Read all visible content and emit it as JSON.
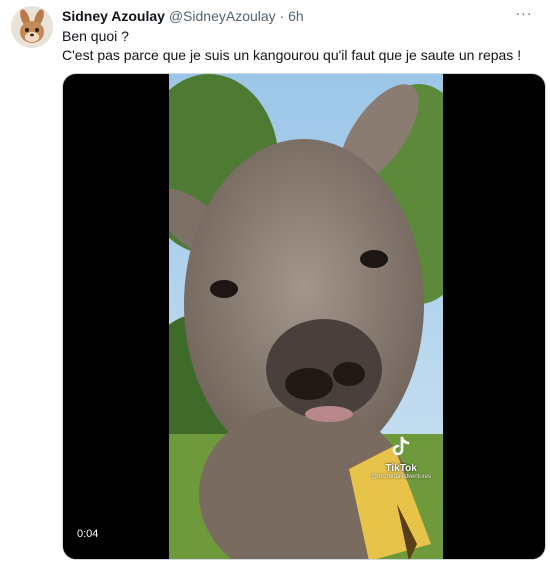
{
  "author": {
    "name": "Sidney Azoulay",
    "handle": "@SidneyAzoulay",
    "separator": "·",
    "time": "6h"
  },
  "more_label": "···",
  "tweet": {
    "lines": [
      "Ben quoi ?",
      "C'est pas parce que je suis un kangourou qu'il faut que je saute un repas !"
    ]
  },
  "media": {
    "watermark_brand": "TikTok",
    "watermark_user": "@mcmedavidventures",
    "duration": "0:04"
  },
  "icons": {
    "avatar": "squirrel-avatar",
    "more": "more-options-icon",
    "tiktok": "tiktok-logo-icon"
  },
  "colors": {
    "text_primary": "#0f1419",
    "text_secondary": "#536471"
  }
}
